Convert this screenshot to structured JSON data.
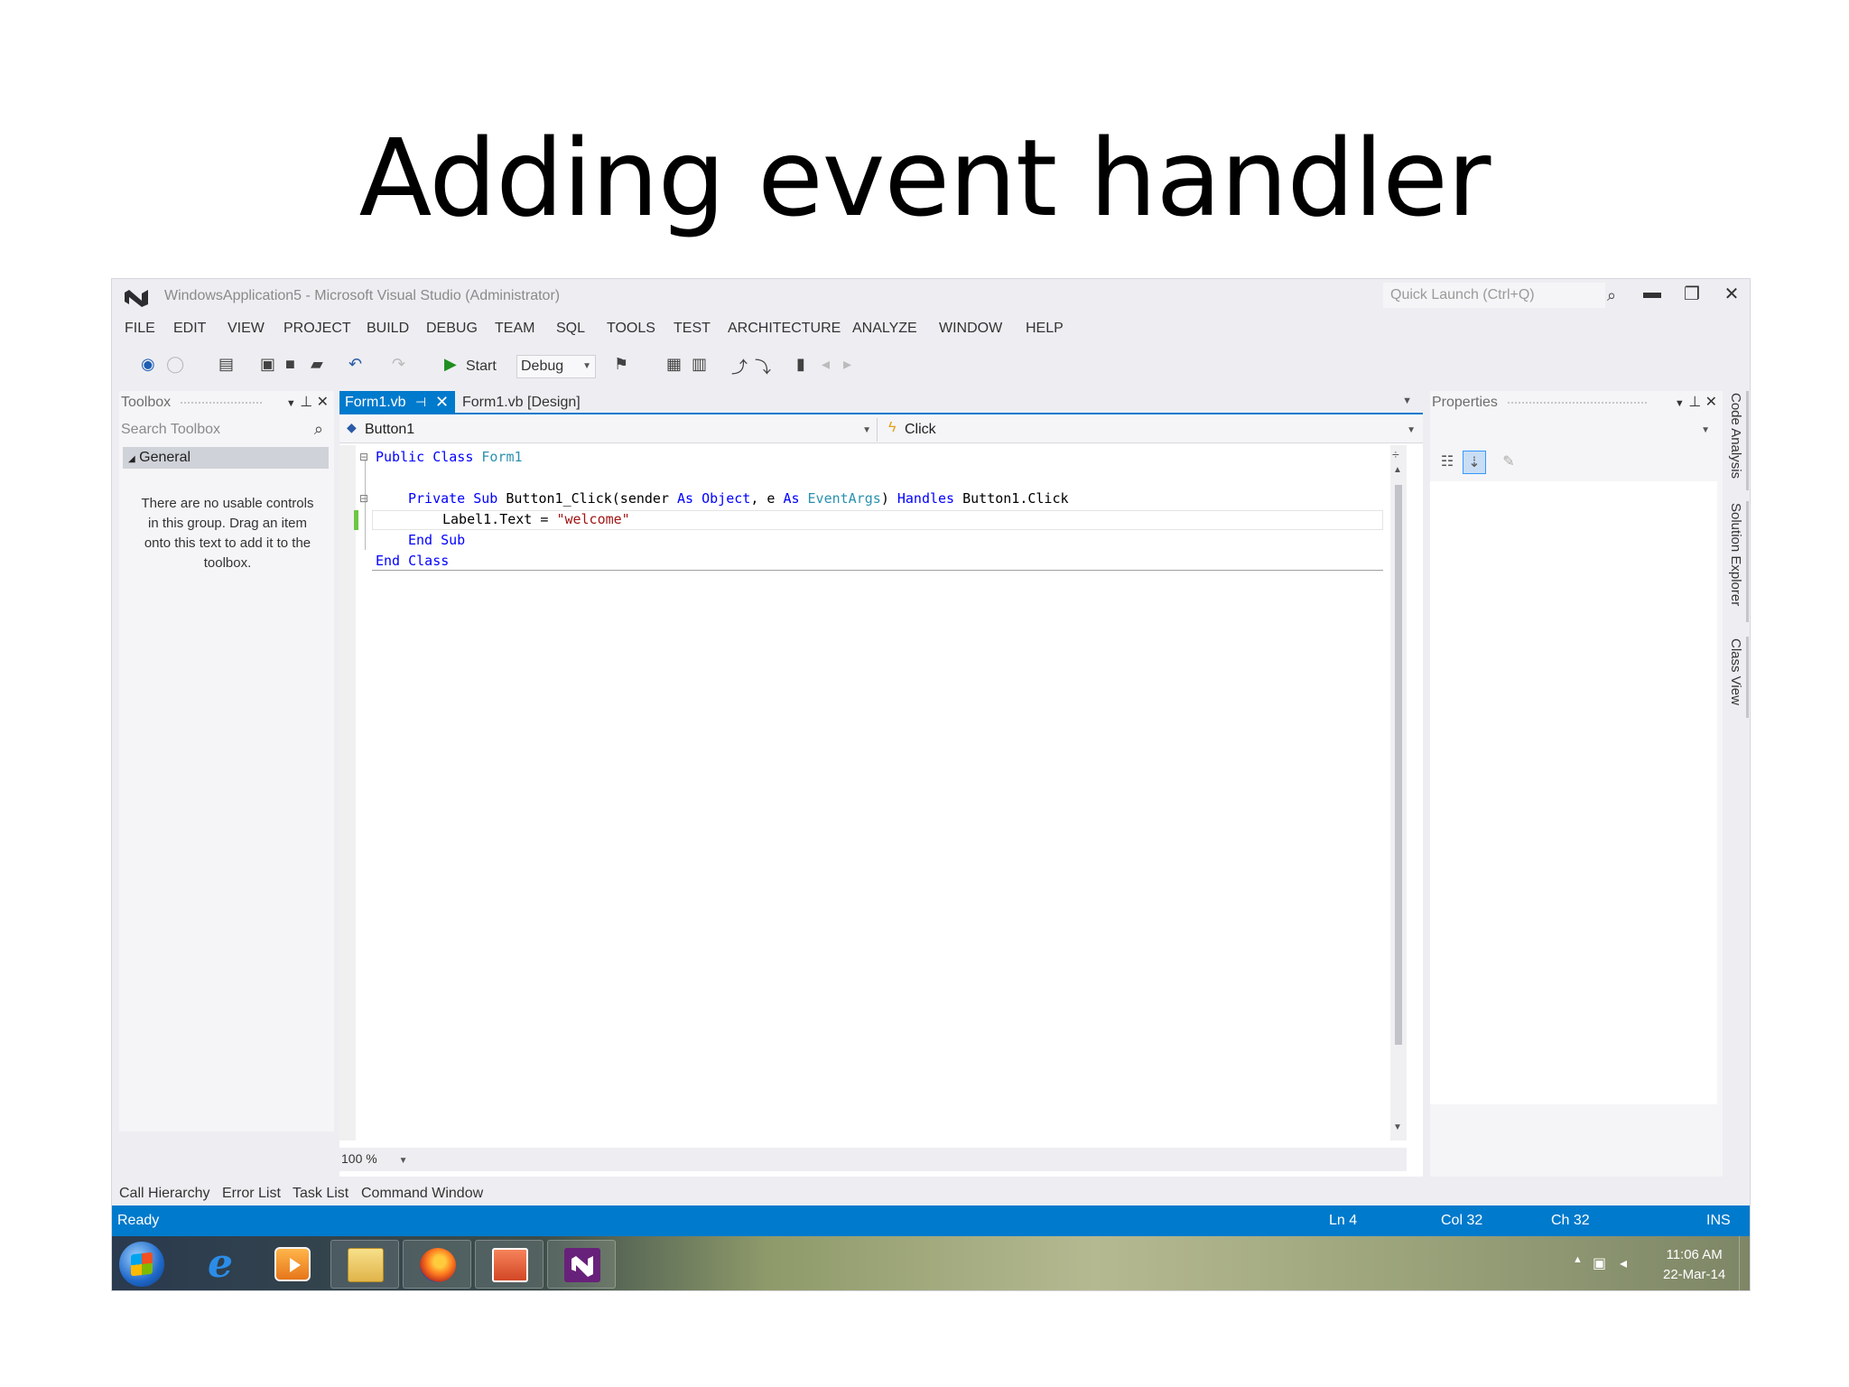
{
  "slide": {
    "title": "Adding event handler"
  },
  "window": {
    "title": "WindowsApplication5 - Microsoft Visual Studio (Administrator)",
    "quick_launch_placeholder": "Quick Launch (Ctrl+Q)",
    "buttons": {
      "search": "⌕",
      "minimize": "▬",
      "restore": "❐",
      "close": "✕"
    }
  },
  "menu": [
    "FILE",
    "EDIT",
    "VIEW",
    "PROJECT",
    "BUILD",
    "DEBUG",
    "TEAM",
    "SQL",
    "TOOLS",
    "TEST",
    "ARCHITECTURE",
    "ANALYZE",
    "WINDOW",
    "HELP"
  ],
  "toolbar": {
    "start_label": "Start",
    "config_value": "Debug"
  },
  "toolbox": {
    "header": "Toolbox",
    "search_placeholder": "Search Toolbox",
    "group": "General",
    "empty_message": "There are no usable controls in this group. Drag an item onto this text to add it to the toolbox."
  },
  "editor": {
    "tabs": [
      {
        "label": "Form1.vb",
        "active": true
      },
      {
        "label": "Form1.vb [Design]",
        "active": false
      }
    ],
    "nav": {
      "object": "Button1",
      "event": "Click"
    },
    "code": {
      "line1": {
        "kw": "Public Class",
        "name": "Form1"
      },
      "line2": {
        "kw1": "Private Sub",
        "sig": "Button1_Click(sender",
        "as1": "As",
        "obj": "Object",
        "comma_e": ", e",
        "as2": "As",
        "args": "EventArgs",
        "close": ")",
        "handles": "Handles",
        "target": "Button1.Click"
      },
      "line3": {
        "stmt": "Label1.Text = ",
        "value": "\"welcome\""
      },
      "line4": {
        "kw": "End Sub"
      },
      "line5": {
        "kw": "End Class"
      }
    },
    "zoom": "100 %"
  },
  "properties": {
    "header": "Properties"
  },
  "side_tabs": [
    "Code Analysis",
    "Solution Explorer",
    "Class View"
  ],
  "bottom_tabs": [
    "Call Hierarchy",
    "Error List",
    "Task List",
    "Command Window"
  ],
  "status": {
    "state": "Ready",
    "line": "Ln 4",
    "col": "Col 32",
    "ch": "Ch 32",
    "mode": "INS"
  },
  "taskbar": {
    "time": "11:06 AM",
    "date": "22-Mar-14",
    "ie_letter": "e"
  },
  "colors": {
    "accent": "#007acc",
    "keyword": "#0000ff",
    "type": "#2b91af",
    "string": "#a31515"
  }
}
